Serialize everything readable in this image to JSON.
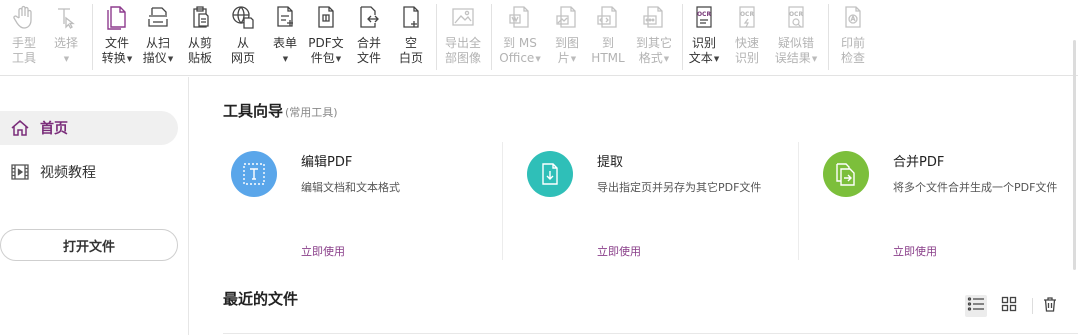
{
  "ribbon": {
    "hand": {
      "l1": "手型",
      "l2": "工具"
    },
    "select": {
      "l1": "选择"
    },
    "file_convert": {
      "l1": "文件",
      "l2": "转换"
    },
    "from_scanner": {
      "l1": "从扫",
      "l2": "描仪"
    },
    "from_clipboard": {
      "l1": "从剪",
      "l2": "贴板"
    },
    "from_web": {
      "l1": "从",
      "l2": "网页"
    },
    "form": {
      "l1": "表单"
    },
    "pdf_package": {
      "l1": "PDF文",
      "l2": "件包"
    },
    "merge": {
      "l1": "合并",
      "l2": "文件"
    },
    "blank_page": {
      "l1": "空",
      "l2": "白页"
    },
    "export_images": {
      "l1": "导出全",
      "l2": "部图像"
    },
    "to_ms_office": {
      "l1": "到 MS",
      "l2": "Office"
    },
    "to_image": {
      "l1": "到图",
      "l2": "片"
    },
    "to_html": {
      "l1": "到",
      "l2": "HTML"
    },
    "to_other": {
      "l1": "到其它",
      "l2": "格式"
    },
    "ocr_text": {
      "l1": "识别",
      "l2": "文本",
      "badge": "OCR"
    },
    "quick_ocr": {
      "l1": "快速",
      "l2": "识别",
      "badge": "OCR"
    },
    "suspect_ocr": {
      "l1": "疑似错",
      "l2": "误结果",
      "badge": "OCR"
    },
    "preflight": {
      "l1": "印前",
      "l2": "检查"
    }
  },
  "sidebar": {
    "home": "首页",
    "video": "视频教程",
    "open_file": "打开文件"
  },
  "main": {
    "tool_guide": "工具向导",
    "tool_guide_sub": "(常用工具)",
    "cards": [
      {
        "title": "编辑PDF",
        "desc": "编辑文档和文本格式",
        "link": "立即使用",
        "color": "#5aa6ea"
      },
      {
        "title": "提取",
        "desc": "导出指定页并另存为其它PDF文件",
        "link": "立即使用",
        "color": "#2fbfb8"
      },
      {
        "title": "合并PDF",
        "desc": "将多个文件合并生成一个PDF文件",
        "link": "立即使用",
        "color": "#7cbf3b"
      }
    ],
    "recent_files": "最近的文件"
  },
  "colors": {
    "accent": "#7a2d7a",
    "link": "#8a3f8a"
  }
}
